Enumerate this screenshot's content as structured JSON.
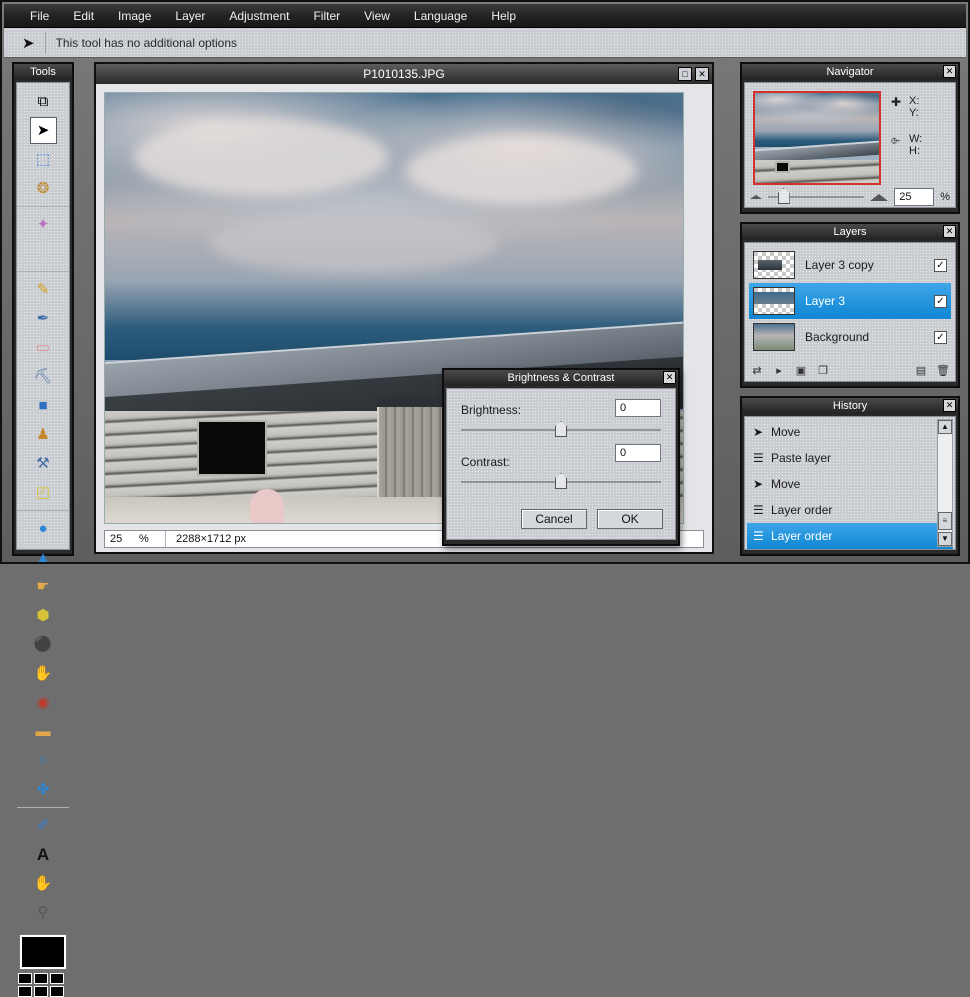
{
  "menubar": {
    "items": [
      "File",
      "Edit",
      "Image",
      "Layer",
      "Adjustment",
      "Filter",
      "View",
      "Language",
      "Help"
    ]
  },
  "options_bar": {
    "tool_icon": "move-tool-icon",
    "text": "This tool has no additional options"
  },
  "tools_panel": {
    "title": "Tools",
    "items": [
      {
        "name": "crop-tool",
        "glyph": "⧉"
      },
      {
        "name": "move-tool",
        "glyph": "➤",
        "active": true
      },
      {
        "name": "rectangle-select-tool",
        "glyph": "⬚"
      },
      {
        "name": "lasso-select-tool",
        "glyph": "❂"
      },
      {
        "name": "magic-wand-tool",
        "glyph": "✦"
      },
      {
        "name": "pencil-tool",
        "glyph": "✎"
      },
      {
        "name": "paintbrush-tool",
        "glyph": "✒"
      },
      {
        "name": "eraser-tool",
        "glyph": "▭"
      },
      {
        "name": "paint-bucket-tool",
        "glyph": "⛏"
      },
      {
        "name": "gradient-tool",
        "glyph": "■"
      },
      {
        "name": "clone-stamp-tool",
        "glyph": "♟"
      },
      {
        "name": "retouch-tool",
        "glyph": "⚒"
      },
      {
        "name": "shape-tool",
        "glyph": "◰"
      },
      {
        "name": "blur-tool",
        "glyph": "●"
      },
      {
        "name": "sharpen-tool",
        "glyph": "▲"
      },
      {
        "name": "smudge-tool",
        "glyph": "☛"
      },
      {
        "name": "sponge-tool",
        "glyph": "⬢"
      },
      {
        "name": "dodge-tool",
        "glyph": "⚫"
      },
      {
        "name": "burn-tool",
        "glyph": "✋"
      },
      {
        "name": "red-eye-tool",
        "glyph": "◉"
      },
      {
        "name": "pill-tool",
        "glyph": "▬"
      },
      {
        "name": "bloat-tool",
        "glyph": "○"
      },
      {
        "name": "pinch-tool",
        "glyph": "✤"
      },
      {
        "name": "eyedropper-tool",
        "glyph": "✐"
      },
      {
        "name": "text-tool",
        "glyph": "A"
      },
      {
        "name": "hand-tool",
        "glyph": "✋"
      },
      {
        "name": "zoom-tool",
        "glyph": "⚲"
      }
    ],
    "foreground_color": "#000000",
    "palette_colors": [
      "#000000",
      "#000000",
      "#000000",
      "#000000",
      "#000000",
      "#000000"
    ]
  },
  "image_window": {
    "title": "P1010135.JPG",
    "maximize_label": "□",
    "close_label": "✕",
    "statusbar": {
      "zoom": "25",
      "percent": "%",
      "dimensions": "2288×1712 px"
    }
  },
  "dialog": {
    "title": "Brightness & Contrast",
    "close_label": "✕",
    "brightness_label": "Brightness:",
    "brightness_value": "0",
    "contrast_label": "Contrast:",
    "contrast_value": "0",
    "cancel_label": "Cancel",
    "ok_label": "OK"
  },
  "navigator": {
    "title": "Navigator",
    "close_label": "✕",
    "x_label": "X:",
    "y_label": "Y:",
    "w_label": "W:",
    "h_label": "H:",
    "crosshair_icon": "crosshair-icon",
    "selection_icon": "selection-icon",
    "zoom_value": "25",
    "zoom_unit": "%",
    "view_box_color": "#d0332c"
  },
  "layers": {
    "title": "Layers",
    "close_label": "✕",
    "selection_color": "#0f86d4",
    "check_glyph": "✓",
    "items": [
      {
        "name": "Layer 3 copy",
        "visible": true,
        "selected": false,
        "type": "transparent"
      },
      {
        "name": "Layer 3",
        "visible": true,
        "selected": true,
        "type": "transparent"
      },
      {
        "name": "Background",
        "visible": true,
        "selected": false,
        "type": "photo"
      }
    ],
    "toolbar": [
      {
        "name": "blend-mode-button",
        "glyph": "⇄"
      },
      {
        "name": "opacity-button",
        "glyph": "▸"
      },
      {
        "name": "layer-mask-button",
        "glyph": "▣"
      },
      {
        "name": "new-layer-button",
        "glyph": "❐"
      },
      {
        "name": "duplicate-layer-button",
        "glyph": "▤"
      },
      {
        "name": "delete-layer-button",
        "glyph": "Ὕ1"
      }
    ]
  },
  "history": {
    "title": "History",
    "close_label": "✕",
    "selection_color": "#0f86d4",
    "items": [
      {
        "label": "Move",
        "icon": "move-icon",
        "glyph": "➤",
        "selected": false
      },
      {
        "label": "Paste layer",
        "icon": "document-icon",
        "glyph": "☰",
        "selected": false
      },
      {
        "label": "Move",
        "icon": "move-icon",
        "glyph": "➤",
        "selected": false
      },
      {
        "label": "Layer order",
        "icon": "document-icon",
        "glyph": "☰",
        "selected": false
      },
      {
        "label": "Layer order",
        "icon": "document-icon",
        "glyph": "☰",
        "selected": true
      }
    ],
    "scroll_up": "▲",
    "scroll_down": "▼",
    "scroll_grip": "≡"
  }
}
